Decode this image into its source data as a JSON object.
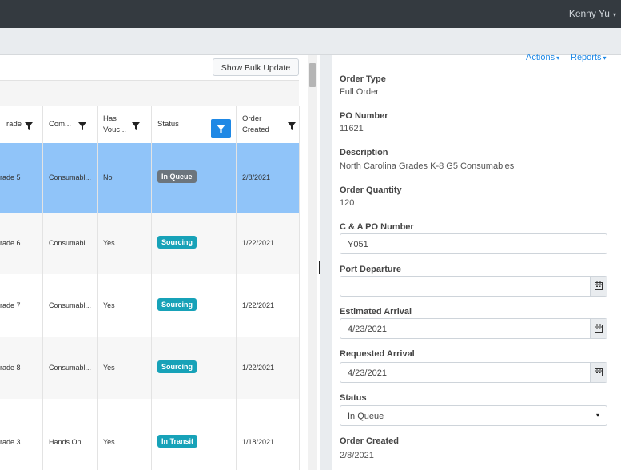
{
  "topbar": {
    "user_name": "Kenny Yu",
    "caret": "▾"
  },
  "toolbar": {
    "bulk_update_label": "Show Bulk Update"
  },
  "columns": [
    {
      "label": "rade"
    },
    {
      "label": "Com..."
    },
    {
      "label_line1": "Has",
      "label_line2": "Vouc..."
    },
    {
      "label": "Status"
    },
    {
      "label_line1": "Order",
      "label_line2": "Created"
    }
  ],
  "rows": [
    {
      "grade": "rade 5",
      "component": "Consumabl...",
      "has_voucher": "No",
      "status": "In Queue",
      "created": "2/8/2021"
    },
    {
      "grade": "rade 6",
      "component": "Consumabl...",
      "has_voucher": "Yes",
      "status": "Sourcing",
      "created": "1/22/2021"
    },
    {
      "grade": "rade 7",
      "component": "Consumabl...",
      "has_voucher": "Yes",
      "status": "Sourcing",
      "created": "1/22/2021"
    },
    {
      "grade": "rade 8",
      "component": "Consumabl...",
      "has_voucher": "Yes",
      "status": "Sourcing",
      "created": "1/22/2021"
    },
    {
      "grade": "rade 3",
      "component": "Hands On",
      "has_voucher": "Yes",
      "status": "In Transit",
      "created": "1/18/2021"
    }
  ],
  "status_colors": {
    "In Queue": "#6c757d",
    "Sourcing": "#17a2b8",
    "In Transit": "#17a2b8",
    "selected_row": "#90c4f9"
  },
  "detail": {
    "actions_label": "Actions",
    "reports_label": "Reports",
    "caret": "▾",
    "order_type_label": "Order Type",
    "order_type_value": "Full Order",
    "po_number_label": "PO Number",
    "po_number_value": "11621",
    "description_label": "Description",
    "description_value": "North Carolina Grades K-8 G5 Consumables",
    "order_quantity_label": "Order Quantity",
    "order_quantity_value": "120",
    "ca_po_label": "C & A PO Number",
    "ca_po_value": "Y051",
    "port_departure_label": "Port Departure",
    "port_departure_value": "",
    "estimated_arrival_label": "Estimated Arrival",
    "estimated_arrival_value": "4/23/2021",
    "requested_arrival_label": "Requested Arrival",
    "requested_arrival_value": "4/23/2021",
    "status_label": "Status",
    "status_value": "In Queue",
    "order_created_label": "Order Created",
    "order_created_value": "2/8/2021"
  }
}
